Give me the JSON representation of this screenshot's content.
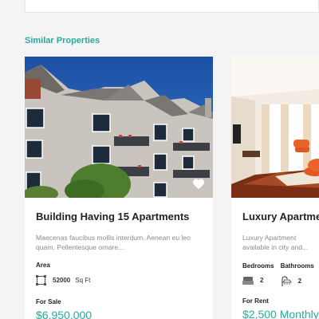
{
  "section": {
    "title": "Similar Properties"
  },
  "properties": [
    {
      "title": "Building Having 15 Apartments",
      "description": "Maecenas faucibus mollis interdum. Aenean eu leo quam. Pellentesque ornare...",
      "area_label": "Area",
      "area_value": "52000",
      "area_unit": "Sq Ft",
      "status": "For Sale",
      "price": "$6,950,000",
      "favorite_icon": "heart-icon"
    },
    {
      "title": "Luxury Apartment",
      "description": "Luxury Apartment available in city and...",
      "bedrooms_label": "Bedrooms",
      "bedrooms_value": "2",
      "bathrooms_label": "Bathrooms",
      "bathrooms_value": "2",
      "status": "For Rent",
      "price": "$2,500 Monthly"
    }
  ],
  "colors": {
    "accent": "#2ba8a0",
    "background": "#f4f4f4"
  }
}
